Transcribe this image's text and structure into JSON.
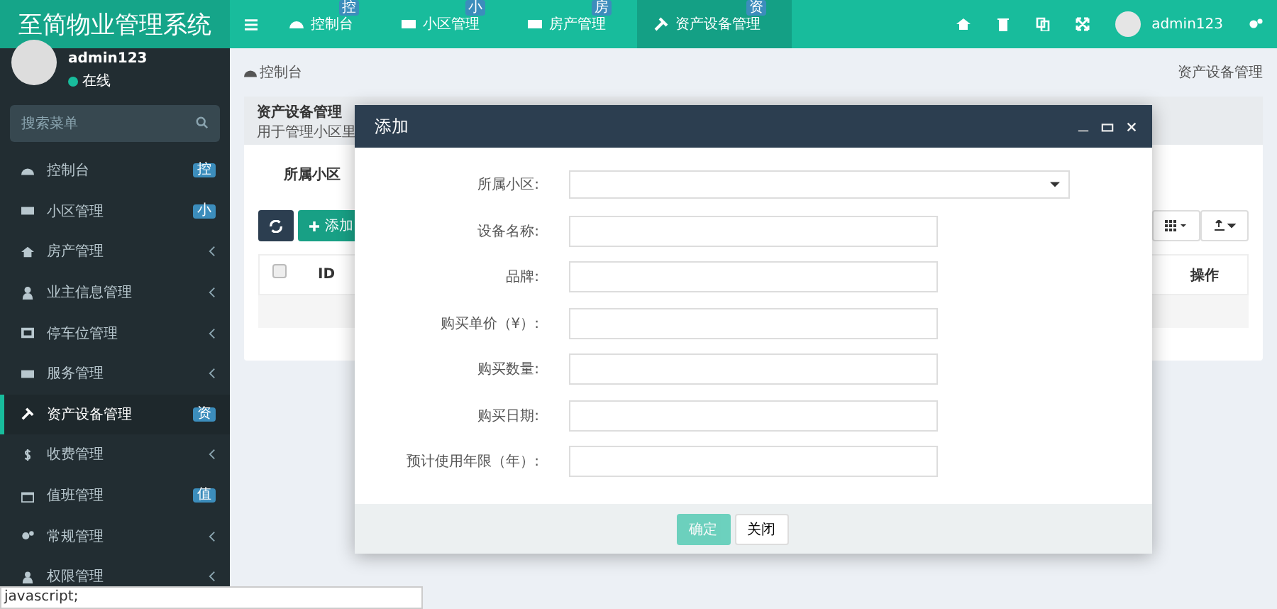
{
  "logo": "至简物业管理系统",
  "top_tabs": [
    {
      "label": "控制台",
      "badge": "控",
      "selected": false
    },
    {
      "label": "小区管理",
      "badge": "小",
      "selected": false
    },
    {
      "label": "房产管理",
      "badge": "房",
      "selected": false
    },
    {
      "label": "资产设备管理",
      "badge": "资",
      "selected": true
    }
  ],
  "user": {
    "name": "admin123",
    "status": "在线"
  },
  "header_user": "admin123",
  "search": {
    "placeholder": "搜索菜单"
  },
  "menu": [
    {
      "label": "控制台",
      "badge": "控",
      "selected": false
    },
    {
      "label": "小区管理",
      "badge": "小",
      "selected": false
    },
    {
      "label": "房产管理",
      "selected": false
    },
    {
      "label": "业主信息管理",
      "selected": false
    },
    {
      "label": "停车位管理",
      "selected": false
    },
    {
      "label": "服务管理",
      "selected": false
    },
    {
      "label": "资产设备管理",
      "badge": "资",
      "selected": true
    },
    {
      "label": "收费管理",
      "selected": false
    },
    {
      "label": "值班管理",
      "badge": "值",
      "selected": false
    },
    {
      "label": "常规管理",
      "selected": false
    },
    {
      "label": "权限管理",
      "selected": false
    }
  ],
  "breadcrumb": {
    "home": "控制台",
    "current": "资产设备管理"
  },
  "panel": {
    "title": "资产设备管理",
    "subtitle": "用于管理小区里",
    "filter_label": "所属小区",
    "add_button": "添加",
    "columns": [
      "ID",
      "操作"
    ],
    "select_all_checked": false
  },
  "dialog": {
    "title": "添加",
    "fields": [
      {
        "label": "所属小区:",
        "kind": "select"
      },
      {
        "label": "设备名称:",
        "kind": "text"
      },
      {
        "label": "品牌:",
        "kind": "text"
      },
      {
        "label": "购买单价（¥）:",
        "kind": "text"
      },
      {
        "label": "购买数量:",
        "kind": "text"
      },
      {
        "label": "购买日期:",
        "kind": "text"
      },
      {
        "label": "预计使用年限（年）:",
        "kind": "text"
      }
    ],
    "confirm": {
      "label": "确定",
      "disabled": true
    },
    "close": "关闭"
  },
  "status_bar": "javascript;"
}
